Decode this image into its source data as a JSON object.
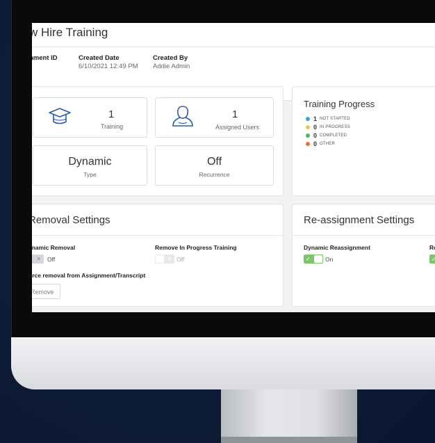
{
  "page": {
    "title": "w Hire Training"
  },
  "meta": {
    "assignment_id_label": "nment ID",
    "created_date_label": "Created Date",
    "created_date_value": "6/10/2021 12:49 PM",
    "created_by_label": "Created By",
    "created_by_value": "Addie Admin"
  },
  "stats": {
    "training_count": "1",
    "training_label": "Training",
    "users_count": "1",
    "users_label": "Assigned Users",
    "type_value": "Dynamic",
    "type_label": "Type",
    "recurrence_value": "Off",
    "recurrence_label": "Recurrence"
  },
  "progress": {
    "title": "Training Progress",
    "items": [
      {
        "count": "1",
        "label": "Not started",
        "color": "#3aa6d8"
      },
      {
        "count": "0",
        "label": "In progress",
        "color": "#f4c542"
      },
      {
        "count": "0",
        "label": "Completed",
        "color": "#47b86a"
      },
      {
        "count": "0",
        "label": "Other",
        "color": "#ec6d3a"
      }
    ]
  },
  "removal": {
    "title": "Removal Settings",
    "dynamic_removal_label": "ynamic Removal",
    "dynamic_removal_state": "Off",
    "remove_in_progress_label": "Remove In Progress Training",
    "remove_in_progress_state": "Off",
    "force_removal_label": "orce removal from Assignment/Transcript",
    "remove_button": "Remove"
  },
  "reassignment": {
    "title": "Re-assignment Settings",
    "dynamic_reassignment_label": "Dynamic Reassignment",
    "dynamic_reassignment_state": "On",
    "second_label_partial": "Re"
  },
  "colors": {
    "toggle_on": "#7bc86c",
    "toggle_off": "#d6d7da",
    "icon_blue": "#2d5aa8"
  }
}
